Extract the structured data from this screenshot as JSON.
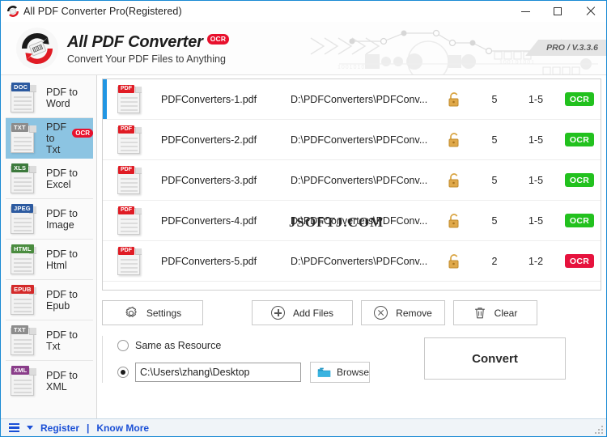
{
  "window": {
    "title": "All PDF Converter Pro(Registered)",
    "app_icon": "app-logo-icon",
    "minimize_label": "—",
    "maximize_label": "□",
    "close_label": "✕"
  },
  "header": {
    "brand_title": "All PDF Converter",
    "brand_ocr_badge": "OCR",
    "brand_subtitle": "Convert Your PDF Files to Anything",
    "version_tag": "PRO / V.3.3.6",
    "accent_red": "#e8112d",
    "art_binary_text": "100101001"
  },
  "sidebar": {
    "items": [
      {
        "label": "PDF to Word",
        "tag": "DOC",
        "tag_color": "#2c5aa0",
        "active": false,
        "ocr": ""
      },
      {
        "label": "PDF to Txt",
        "tag": "TXT",
        "tag_color": "#8c8c8c",
        "active": true,
        "ocr": "OCR"
      },
      {
        "label": "PDF to Excel",
        "tag": "XLS",
        "tag_color": "#3d7a3d",
        "active": false,
        "ocr": ""
      },
      {
        "label": "PDF to Image",
        "tag": "JPEG",
        "tag_color": "#2c5aa0",
        "active": false,
        "ocr": ""
      },
      {
        "label": "PDF to Html",
        "tag": "HTML",
        "tag_color": "#4a8c3f",
        "active": false,
        "ocr": ""
      },
      {
        "label": "PDF to Epub",
        "tag": "EPUB",
        "tag_color": "#d42a2a",
        "active": false,
        "ocr": ""
      },
      {
        "label": "PDF to Txt",
        "tag": "TXT",
        "tag_color": "#8c8c8c",
        "active": false,
        "ocr": ""
      },
      {
        "label": "PDF to XML",
        "tag": "XML",
        "tag_color": "#8a3d8a",
        "active": false,
        "ocr": ""
      }
    ],
    "selection_color": "#8cc4e2"
  },
  "filelist": {
    "watermark": "JSOFTJ.COM",
    "rows": [
      {
        "name": "PDFConverters-1.pdf",
        "path": "D:\\PDFConverters\\PDFConv...",
        "locked": "unlocked",
        "pages": "5",
        "range": "1-5",
        "ocr": "OCR",
        "ocr_color": "#22c11e",
        "selected": true
      },
      {
        "name": "PDFConverters-2.pdf",
        "path": "D:\\PDFConverters\\PDFConv...",
        "locked": "unlocked",
        "pages": "5",
        "range": "1-5",
        "ocr": "OCR",
        "ocr_color": "#22c11e",
        "selected": false
      },
      {
        "name": "PDFConverters-3.pdf",
        "path": "D:\\PDFConverters\\PDFConv...",
        "locked": "unlocked",
        "pages": "5",
        "range": "1-5",
        "ocr": "OCR",
        "ocr_color": "#22c11e",
        "selected": false
      },
      {
        "name": "PDFConverters-4.pdf",
        "path": "D:\\PDFConverters\\PDFConv...",
        "locked": "unlocked",
        "pages": "5",
        "range": "1-5",
        "ocr": "OCR",
        "ocr_color": "#22c11e",
        "selected": false
      },
      {
        "name": "PDFConverters-5.pdf",
        "path": "D:\\PDFConverters\\PDFConv...",
        "locked": "unlocked",
        "pages": "2",
        "range": "1-2",
        "ocr": "OCR",
        "ocr_color": "#e6123d",
        "selected": false
      }
    ]
  },
  "toolbar": {
    "settings_label": "Settings",
    "add_files_label": "Add Files",
    "remove_label": "Remove",
    "clear_label": "Clear"
  },
  "output": {
    "same_as_resource_label": "Same as Resource",
    "same_as_resource_selected": false,
    "custom_path_selected": true,
    "path_value": "C:\\Users\\zhang\\Desktop",
    "browse_label": "Browse",
    "convert_label": "Convert"
  },
  "statusbar": {
    "menu_icon": "list-menu-icon",
    "register_label": "Register",
    "separator": "|",
    "know_more_label": "Know More"
  }
}
